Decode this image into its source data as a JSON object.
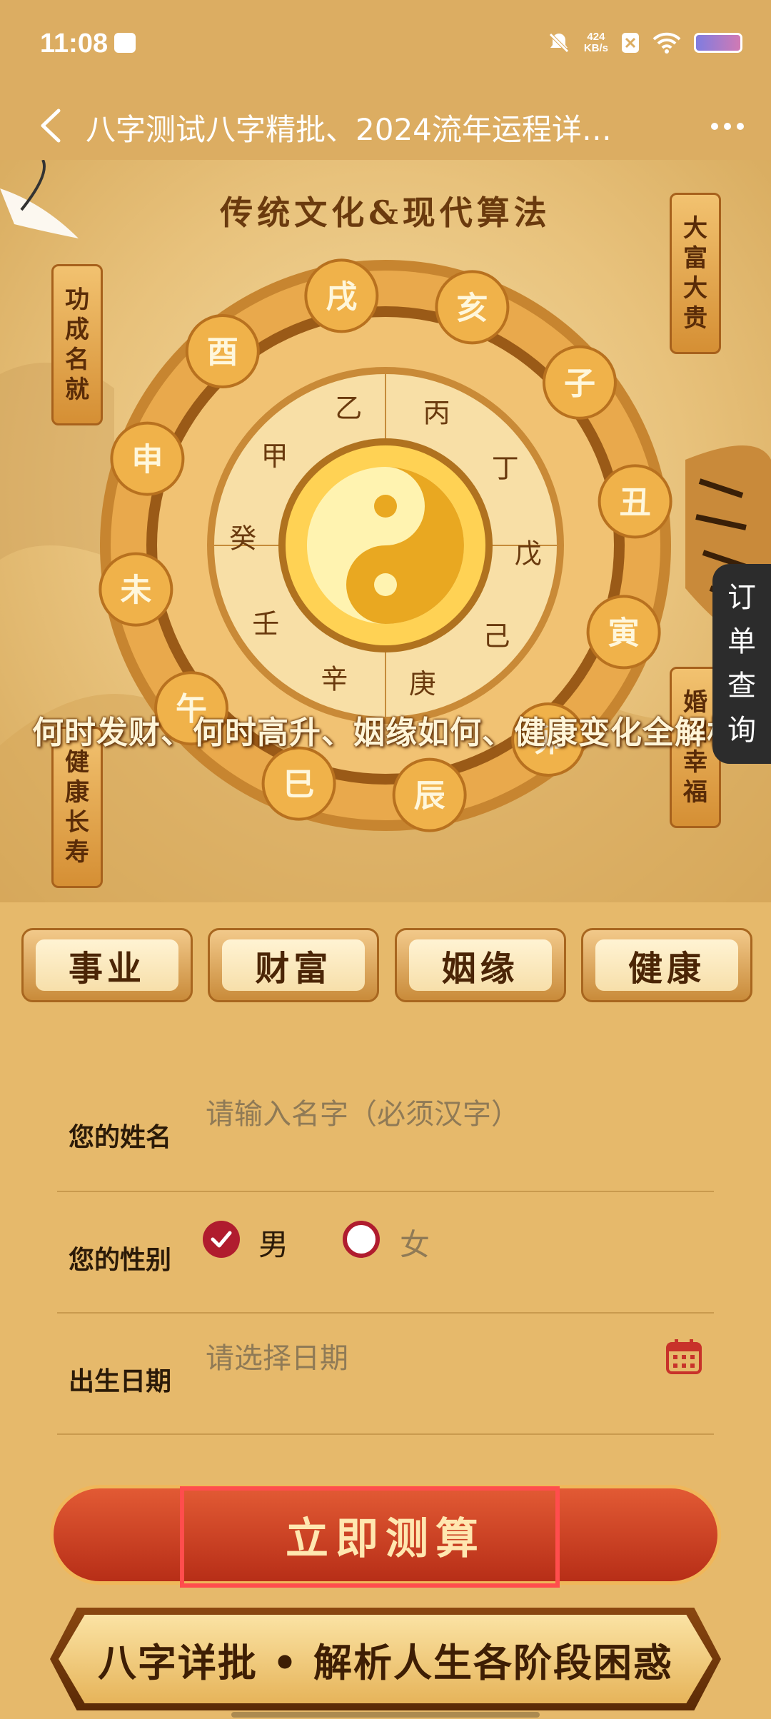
{
  "status_bar": {
    "time": "11:08",
    "net_speed_value": "424",
    "net_speed_unit": "KB/s"
  },
  "nav": {
    "title": "八字测试八字精批、2024流年运程详…"
  },
  "hero": {
    "subtitle": "传统文化&现代算法",
    "tags": {
      "left_top": "功成名就",
      "right_top": "大富大贵",
      "left_bottom": "健康长寿",
      "right_bottom": "婚姻幸福"
    },
    "earthly_branches": [
      "戌",
      "亥",
      "子",
      "丑",
      "寅",
      "卯",
      "辰",
      "巳",
      "午",
      "未",
      "申",
      "酉"
    ],
    "heavenly_stems": [
      "乙",
      "丙",
      "丁",
      "戊",
      "己",
      "庚",
      "辛",
      "壬",
      "癸",
      "甲"
    ],
    "slogan": "何时发财、何时高升、姻缘如何、健康变化全解析"
  },
  "categories": [
    "事业",
    "财富",
    "姻缘",
    "健康"
  ],
  "form": {
    "name_label": "您的姓名",
    "name_placeholder": "请输入名字（必须汉字）",
    "gender_label": "您的性别",
    "gender_male": "男",
    "gender_female": "女",
    "selected_gender": "男",
    "birth_label": "出生日期",
    "birth_placeholder": "请选择日期"
  },
  "submit_label": "立即测算",
  "banner_text": "八字详批 • 解析人生各阶段困惑",
  "order_button": [
    "订",
    "单",
    "查",
    "询"
  ],
  "colors": {
    "accent_red": "#b01c2e",
    "gold": "#e6b96b",
    "dark_brown": "#4b2506"
  }
}
